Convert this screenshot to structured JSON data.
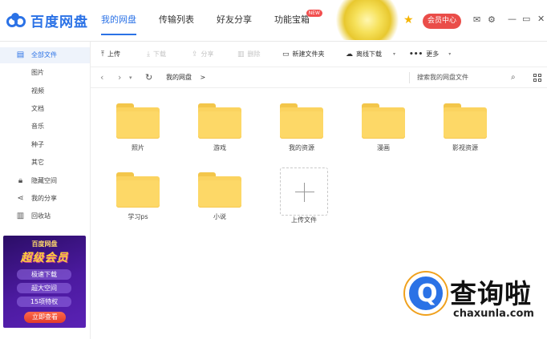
{
  "app": {
    "logo_text": "百度网盘",
    "accent": "#2b72e6"
  },
  "nav": {
    "tabs": [
      {
        "label": "我的网盘"
      },
      {
        "label": "传输列表"
      },
      {
        "label": "好友分享"
      },
      {
        "label": "功能宝箱"
      }
    ],
    "new_badge": "NEW",
    "vip_label": "会员中心"
  },
  "sidebar": {
    "items": [
      {
        "label": "全部文件",
        "icon": "document-icon"
      },
      {
        "label": "图片"
      },
      {
        "label": "视频"
      },
      {
        "label": "文档"
      },
      {
        "label": "音乐"
      },
      {
        "label": "种子"
      },
      {
        "label": "其它"
      },
      {
        "label": "隐藏空间",
        "icon": "lock-icon"
      },
      {
        "label": "我的分享",
        "icon": "share-icon"
      },
      {
        "label": "回收站",
        "icon": "trash-icon"
      }
    ],
    "banner": {
      "brand": "百度网盘",
      "title": "超级会员",
      "tags": [
        "极速下载",
        "超大空间",
        "15项特权"
      ],
      "cta": "立即查看"
    }
  },
  "toolbar": {
    "upload": "上传",
    "download": "下载",
    "share": "分享",
    "delete": "删除",
    "new_folder": "新建文件夹",
    "offline_download": "离线下载",
    "more": "更多"
  },
  "addressbar": {
    "breadcrumb": "我的网盘",
    "breadcrumb_sep": ">",
    "search_placeholder": "搜索我的网盘文件"
  },
  "files": [
    {
      "name": "照片"
    },
    {
      "name": "游戏"
    },
    {
      "name": "我的资源"
    },
    {
      "name": "漫画"
    },
    {
      "name": "影视资源"
    },
    {
      "name": "学习ps"
    },
    {
      "name": "小说"
    }
  ],
  "upload_tile": {
    "label": "上传文件"
  },
  "watermark": {
    "text": "查询啦",
    "url": "chaxunla.com"
  }
}
